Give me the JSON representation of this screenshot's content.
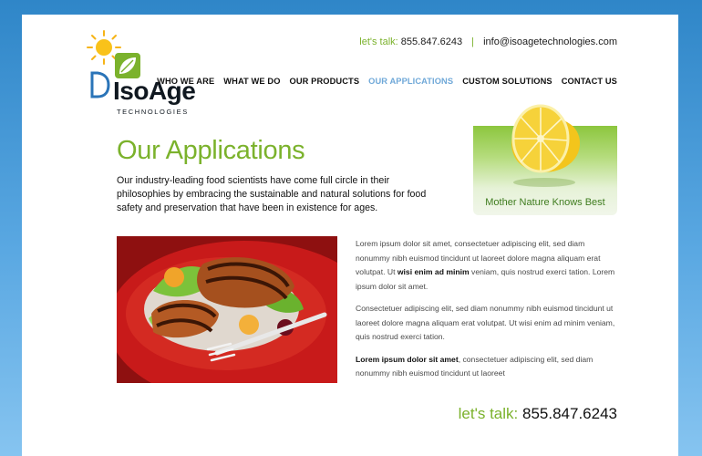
{
  "brand": {
    "name": "IsoAge",
    "tagline": "TECHNOLOGIES"
  },
  "header": {
    "contact_label": "let's talk:",
    "phone": "855.847.6243",
    "separator": "|",
    "email": "info@isoagetechnologies.com"
  },
  "nav": {
    "items": [
      {
        "label": "WHO WE ARE"
      },
      {
        "label": "WHAT WE DO"
      },
      {
        "label": "OUR PRODUCTS"
      },
      {
        "label": "OUR APPLICATIONS"
      },
      {
        "label": "CUSTOM SOLUTIONS"
      },
      {
        "label": "CONTACT US"
      }
    ],
    "active_index": 3,
    "active_color": "#6fa8d8"
  },
  "promo": {
    "caption": "Mother Nature Knows Best"
  },
  "main": {
    "title": "Our Applications",
    "intro": "Our industry-leading food scientists have come full circle in their philosophies by embracing the sustainable and natural solutions for food safety and preservation that have been in existence for ages.",
    "paragraphs": [
      {
        "before": "Lorem ipsum dolor sit amet, consectetuer adipiscing elit, sed diam nonummy nibh euismod tincidunt ut laoreet dolore magna aliquam erat volutpat. Ut ",
        "bold": "wisi enim ad minim",
        "after": " veniam, quis nostrud exerci tation. Lorem ipsum dolor sit amet."
      },
      {
        "before": "Consectetuer adipiscing elit, sed diam nonummy nibh euismod tincidunt ut laoreet dolore magna aliquam erat volutpat. Ut wisi enim ad minim veniam, quis nostrud exerci tation.",
        "bold": "",
        "after": ""
      },
      {
        "before": "",
        "bold": "Lorem ipsum dolor sit amet",
        "after": ", consectetuer adipiscing elit, sed diam nonummy nibh euismod tincidunt ut laoreet"
      }
    ]
  },
  "footer_contact": {
    "label": "let's talk:",
    "phone": "855.847.6243"
  },
  "colors": {
    "brand_green": "#7bb22c",
    "background_blue": "#2f86c8",
    "nav_active": "#6fa8d8"
  }
}
